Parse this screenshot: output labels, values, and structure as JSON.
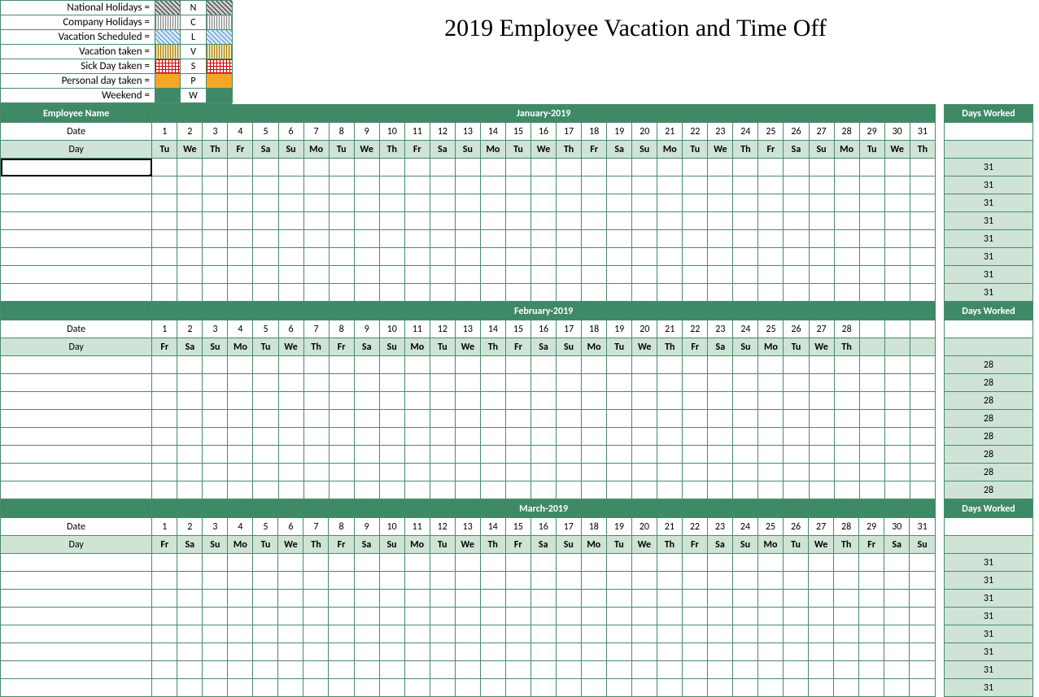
{
  "title": "2019 Employee Vacation and Time Off",
  "legend": [
    {
      "label": "National Holidays =",
      "code": "N"
    },
    {
      "label": "Company Holidays =",
      "code": "C"
    },
    {
      "label": "Vacation Scheduled =",
      "code": "L"
    },
    {
      "label": "Vacation taken =",
      "code": "V"
    },
    {
      "label": "Sick Day taken =",
      "code": "S"
    },
    {
      "label": "Personal day taken =",
      "code": "P"
    },
    {
      "label": "Weekend =",
      "code": "W"
    }
  ],
  "headers": {
    "employee_name": "Employee Name",
    "date": "Date",
    "day": "Day",
    "days_worked": "Days Worked"
  },
  "months": [
    {
      "name": "January-2019",
      "dates": [
        "1",
        "2",
        "3",
        "4",
        "5",
        "6",
        "7",
        "8",
        "9",
        "10",
        "11",
        "12",
        "13",
        "14",
        "15",
        "16",
        "17",
        "18",
        "19",
        "20",
        "21",
        "22",
        "23",
        "24",
        "25",
        "26",
        "27",
        "28",
        "29",
        "30",
        "31"
      ],
      "days": [
        "Tu",
        "We",
        "Th",
        "Fr",
        "Sa",
        "Su",
        "Mo",
        "Tu",
        "We",
        "Th",
        "Fr",
        "Sa",
        "Su",
        "Mo",
        "Tu",
        "We",
        "Th",
        "Fr",
        "Sa",
        "Su",
        "Mo",
        "Tu",
        "We",
        "Th",
        "Fr",
        "Sa",
        "Su",
        "Mo",
        "Tu",
        "We",
        "Th"
      ],
      "employee_rows": 8,
      "days_worked": [
        "31",
        "31",
        "31",
        "31",
        "31",
        "31",
        "31",
        "31"
      ]
    },
    {
      "name": "February-2019",
      "dates": [
        "1",
        "2",
        "3",
        "4",
        "5",
        "6",
        "7",
        "8",
        "9",
        "10",
        "11",
        "12",
        "13",
        "14",
        "15",
        "16",
        "17",
        "18",
        "19",
        "20",
        "21",
        "22",
        "23",
        "24",
        "25",
        "26",
        "27",
        "28",
        "",
        "",
        ""
      ],
      "days": [
        "Fr",
        "Sa",
        "Su",
        "Mo",
        "Tu",
        "We",
        "Th",
        "Fr",
        "Sa",
        "Su",
        "Mo",
        "Tu",
        "We",
        "Th",
        "Fr",
        "Sa",
        "Su",
        "Mo",
        "Tu",
        "We",
        "Th",
        "Fr",
        "Sa",
        "Su",
        "Mo",
        "Tu",
        "We",
        "Th",
        "",
        "",
        ""
      ],
      "employee_rows": 8,
      "days_worked": [
        "28",
        "28",
        "28",
        "28",
        "28",
        "28",
        "28",
        "28"
      ]
    },
    {
      "name": "March-2019",
      "dates": [
        "1",
        "2",
        "3",
        "4",
        "5",
        "6",
        "7",
        "8",
        "9",
        "10",
        "11",
        "12",
        "13",
        "14",
        "15",
        "16",
        "17",
        "18",
        "19",
        "20",
        "21",
        "22",
        "23",
        "24",
        "25",
        "26",
        "27",
        "28",
        "29",
        "30",
        "31"
      ],
      "days": [
        "Fr",
        "Sa",
        "Su",
        "Mo",
        "Tu",
        "We",
        "Th",
        "Fr",
        "Sa",
        "Su",
        "Mo",
        "Tu",
        "We",
        "Th",
        "Fr",
        "Sa",
        "Su",
        "Mo",
        "Tu",
        "We",
        "Th",
        "Fr",
        "Sa",
        "Su",
        "Mo",
        "Tu",
        "We",
        "Th",
        "Fr",
        "Sa",
        "Su"
      ],
      "employee_rows": 8,
      "days_worked": [
        "31",
        "31",
        "31",
        "31",
        "31",
        "31",
        "31",
        "31"
      ]
    }
  ]
}
